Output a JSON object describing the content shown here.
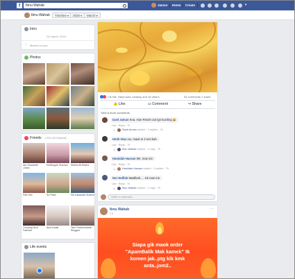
{
  "topbar": {
    "logo": "f",
    "search_value": "Ibnu Wahab",
    "profile_name": "Jamon",
    "nav_home": "Home",
    "nav_create": "Create",
    "brand_color": "#3b5998"
  },
  "subbar": {
    "name": "Ibnu Wahab",
    "timeline_label": "Timeline",
    "year_label": "2020",
    "month_label": "March"
  },
  "intro": {
    "title": "Intro",
    "date_line": "24 march, 2019",
    "married": "Married to you"
  },
  "photos": {
    "title": "Photos"
  },
  "friends": {
    "title": "Friends",
    "count": "1,349 (119 Mutual)",
    "people": [
      {
        "name": "Nor Shazielah Johan"
      },
      {
        "name": "Norlfeqqah Shaziza"
      },
      {
        "name": "Marina Bt Rasha"
      },
      {
        "name": "Fifie Shir"
      },
      {
        "name": "Su Pesni"
      },
      {
        "name": "Siti zubaedah Shamsi"
      },
      {
        "name": "Lhouang Noor Fatehah"
      },
      {
        "name": "Aina Ismail"
      },
      {
        "name": "Tsim Rosshimahnin Ringgan"
      }
    ]
  },
  "life_events": {
    "title": "Life events"
  },
  "post": {
    "reactions": "Cik Nik, Nana kara Junassy and 16 others",
    "comment_shares": "34 comments 1 share",
    "like_label": "Like",
    "comment_label": "Comment",
    "share_label": "Share",
    "view_more": "View 6 more comments",
    "comments": [
      {
        "name": "Izael Jaman",
        "text": "Kna. moe Rm20 cod rgn kuching 😄",
        "meta": "Like · Reply · 7h"
      },
      {
        "name": "Hmih Hisa",
        "text": "Uu. mauk m 2 mei kah.",
        "meta": "Like · Reply · 7h"
      },
      {
        "name": "Hamidah Hassan",
        "text": "Ms. mas m2.",
        "meta": "Like · Reply · 7h"
      },
      {
        "name": "Nor Helifah",
        "text": "Maslikah..... Kk mas m2.",
        "meta": "Like · Reply · 7h"
      }
    ],
    "replies": [
      {
        "name": "Saah Arman",
        "text": "replied · 2 replies · 7h"
      },
      {
        "name": "Ibnu Wahab",
        "text": "replied · 1 reply · 7h"
      },
      {
        "name": "Hamidah Hassan",
        "text": "replied · 2 replies · 7h"
      },
      {
        "name": "Ibnu Wahab",
        "text": "replied · 1 reply · 7h"
      }
    ],
    "write_comment": "Write a comment..."
  },
  "post2": {
    "author": "Ibnu Wahab",
    "time": "1 h",
    "promo_line1": "Siapa gik maok order",
    "promo_line2": "\"ApamBalik Mak kamek\" tk",
    "promo_line3": "komen jak..ptg klk kmk",
    "promo_line4": "anta..jom2.."
  }
}
